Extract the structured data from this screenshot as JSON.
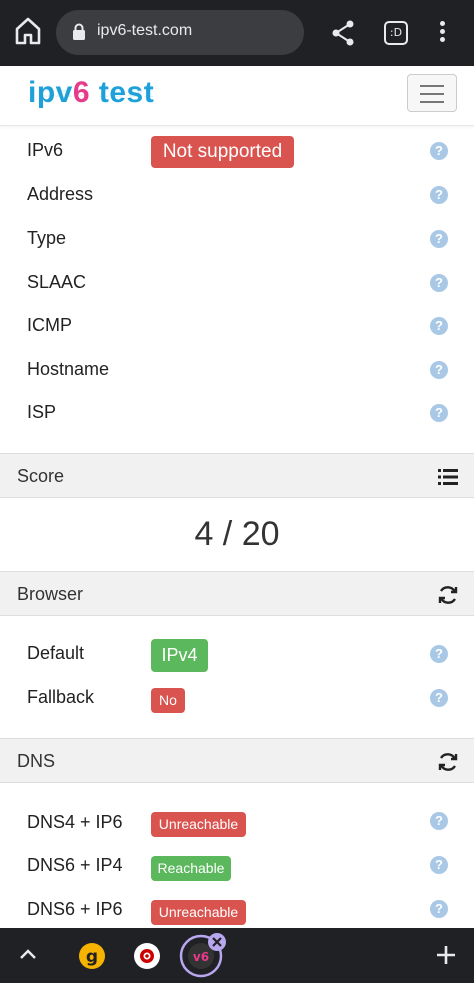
{
  "browser": {
    "url": "ipv6-test.com",
    "tabs_count": ":D"
  },
  "site": {
    "logo_prefix": "ipv",
    "logo_six": "6",
    "logo_suffix": " test"
  },
  "connection": {
    "rows": [
      {
        "label": "IPv6",
        "badge": "Not supported"
      },
      {
        "label": "Address"
      },
      {
        "label": "Type"
      },
      {
        "label": "SLAAC"
      },
      {
        "label": "ICMP"
      },
      {
        "label": "Hostname"
      },
      {
        "label": "ISP"
      }
    ]
  },
  "score_section": {
    "title": "Score",
    "value": "4 / 20"
  },
  "browser_section": {
    "title": "Browser",
    "rows": [
      {
        "label": "Default",
        "badge": "IPv4"
      },
      {
        "label": "Fallback",
        "badge": "No"
      }
    ]
  },
  "dns_section": {
    "title": "DNS",
    "rows": [
      {
        "label": "DNS4 + IP6",
        "badge": "Unreachable"
      },
      {
        "label": "DNS6 + IP4",
        "badge": "Reachable"
      },
      {
        "label": "DNS6 + IP6",
        "badge": "Unreachable"
      }
    ]
  },
  "help_glyph": "?",
  "tab_strip": {
    "tab1_glyph": "g",
    "tab3_glyph": "v6"
  },
  "colors": {
    "danger": "#d9534f",
    "success": "#5cb85c",
    "logo_blue": "#1ea1d8",
    "logo_pink": "#e63a8a"
  }
}
